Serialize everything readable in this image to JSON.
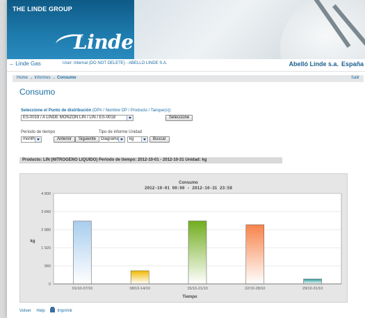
{
  "banner": {
    "group_name": "THE LINDE GROUP",
    "logo_text": "Linde"
  },
  "topbar": {
    "brand": "→ Linde Gas",
    "user": "User: Internal (DO NOT DELETE) - ABELLO LINDE S.A.",
    "company": "Abelló Linde s.a.",
    "country": "España"
  },
  "breadcrumb": {
    "home": "Home",
    "sep": "→",
    "informes": "Informes",
    "current": "Consumo",
    "logout": "Salir"
  },
  "page_title": "Consumo",
  "selector": {
    "label_bold": "Seleccione el Punto de distribución",
    "label_rest": " (DP# / Nombre DP / Producto / Tanque(s))",
    "value": "ES-0019 / A LINDE MONZON LIN / LIN / ES-0018",
    "button": "Seleccione"
  },
  "controls": {
    "period_label": "Período de tiempo",
    "period_value": "month",
    "prev_button": "Anterior",
    "next_button": "Siguiente",
    "type_label": "Tipo de informe Unidad",
    "type_value": "Diagrama",
    "unit_value": "kg",
    "search_button": "Buscar"
  },
  "info_bar": "Producto: LIN (NITROGENO LIQUIDO)   Período de tiempo: 2012-10-01 - 2012-10-31   Unidad: kg",
  "chart_data": {
    "type": "bar",
    "title": "Consumo",
    "subtitle": "2012-10-01 00:00 - 2012-10-31 23:59",
    "xlabel": "Tiempo",
    "ylabel": "kg",
    "ylim": [
      0,
      4800
    ],
    "yticks": [
      "4 800",
      "3 840",
      "2 880",
      "1 920",
      "960",
      "0"
    ],
    "ytick_values": [
      4800,
      3840,
      2880,
      1920,
      960,
      0
    ],
    "categories": [
      "01/10-07/10",
      "08/10-14/10",
      "15/10-21/10",
      "22/10-28/10",
      "29/10-31/10"
    ],
    "values": [
      3330,
      700,
      3340,
      3140,
      260
    ],
    "colors": [
      "#a9cdee",
      "#f2b900",
      "#71ad1e",
      "#f7834a",
      "#2a9a9b"
    ],
    "grid": true
  },
  "footer": {
    "back": "Volver",
    "help": "Help",
    "print": "Imprimir"
  }
}
